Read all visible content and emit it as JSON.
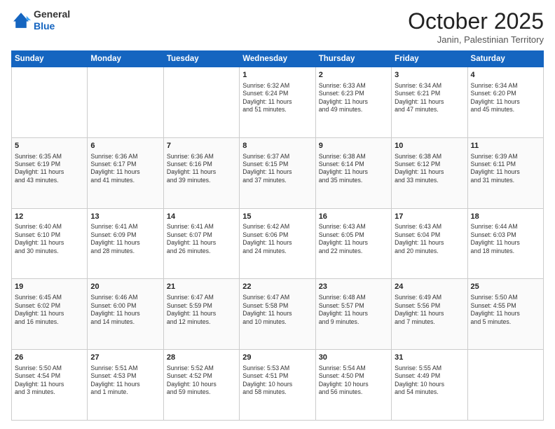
{
  "header": {
    "logo_line1": "General",
    "logo_line2": "Blue",
    "month": "October 2025",
    "location": "Janin, Palestinian Territory"
  },
  "weekdays": [
    "Sunday",
    "Monday",
    "Tuesday",
    "Wednesday",
    "Thursday",
    "Friday",
    "Saturday"
  ],
  "weeks": [
    [
      {
        "day": "",
        "info": ""
      },
      {
        "day": "",
        "info": ""
      },
      {
        "day": "",
        "info": ""
      },
      {
        "day": "1",
        "info": "Sunrise: 6:32 AM\nSunset: 6:24 PM\nDaylight: 11 hours\nand 51 minutes."
      },
      {
        "day": "2",
        "info": "Sunrise: 6:33 AM\nSunset: 6:23 PM\nDaylight: 11 hours\nand 49 minutes."
      },
      {
        "day": "3",
        "info": "Sunrise: 6:34 AM\nSunset: 6:21 PM\nDaylight: 11 hours\nand 47 minutes."
      },
      {
        "day": "4",
        "info": "Sunrise: 6:34 AM\nSunset: 6:20 PM\nDaylight: 11 hours\nand 45 minutes."
      }
    ],
    [
      {
        "day": "5",
        "info": "Sunrise: 6:35 AM\nSunset: 6:19 PM\nDaylight: 11 hours\nand 43 minutes."
      },
      {
        "day": "6",
        "info": "Sunrise: 6:36 AM\nSunset: 6:17 PM\nDaylight: 11 hours\nand 41 minutes."
      },
      {
        "day": "7",
        "info": "Sunrise: 6:36 AM\nSunset: 6:16 PM\nDaylight: 11 hours\nand 39 minutes."
      },
      {
        "day": "8",
        "info": "Sunrise: 6:37 AM\nSunset: 6:15 PM\nDaylight: 11 hours\nand 37 minutes."
      },
      {
        "day": "9",
        "info": "Sunrise: 6:38 AM\nSunset: 6:14 PM\nDaylight: 11 hours\nand 35 minutes."
      },
      {
        "day": "10",
        "info": "Sunrise: 6:38 AM\nSunset: 6:12 PM\nDaylight: 11 hours\nand 33 minutes."
      },
      {
        "day": "11",
        "info": "Sunrise: 6:39 AM\nSunset: 6:11 PM\nDaylight: 11 hours\nand 31 minutes."
      }
    ],
    [
      {
        "day": "12",
        "info": "Sunrise: 6:40 AM\nSunset: 6:10 PM\nDaylight: 11 hours\nand 30 minutes."
      },
      {
        "day": "13",
        "info": "Sunrise: 6:41 AM\nSunset: 6:09 PM\nDaylight: 11 hours\nand 28 minutes."
      },
      {
        "day": "14",
        "info": "Sunrise: 6:41 AM\nSunset: 6:07 PM\nDaylight: 11 hours\nand 26 minutes."
      },
      {
        "day": "15",
        "info": "Sunrise: 6:42 AM\nSunset: 6:06 PM\nDaylight: 11 hours\nand 24 minutes."
      },
      {
        "day": "16",
        "info": "Sunrise: 6:43 AM\nSunset: 6:05 PM\nDaylight: 11 hours\nand 22 minutes."
      },
      {
        "day": "17",
        "info": "Sunrise: 6:43 AM\nSunset: 6:04 PM\nDaylight: 11 hours\nand 20 minutes."
      },
      {
        "day": "18",
        "info": "Sunrise: 6:44 AM\nSunset: 6:03 PM\nDaylight: 11 hours\nand 18 minutes."
      }
    ],
    [
      {
        "day": "19",
        "info": "Sunrise: 6:45 AM\nSunset: 6:02 PM\nDaylight: 11 hours\nand 16 minutes."
      },
      {
        "day": "20",
        "info": "Sunrise: 6:46 AM\nSunset: 6:00 PM\nDaylight: 11 hours\nand 14 minutes."
      },
      {
        "day": "21",
        "info": "Sunrise: 6:47 AM\nSunset: 5:59 PM\nDaylight: 11 hours\nand 12 minutes."
      },
      {
        "day": "22",
        "info": "Sunrise: 6:47 AM\nSunset: 5:58 PM\nDaylight: 11 hours\nand 10 minutes."
      },
      {
        "day": "23",
        "info": "Sunrise: 6:48 AM\nSunset: 5:57 PM\nDaylight: 11 hours\nand 9 minutes."
      },
      {
        "day": "24",
        "info": "Sunrise: 6:49 AM\nSunset: 5:56 PM\nDaylight: 11 hours\nand 7 minutes."
      },
      {
        "day": "25",
        "info": "Sunrise: 5:50 AM\nSunset: 4:55 PM\nDaylight: 11 hours\nand 5 minutes."
      }
    ],
    [
      {
        "day": "26",
        "info": "Sunrise: 5:50 AM\nSunset: 4:54 PM\nDaylight: 11 hours\nand 3 minutes."
      },
      {
        "day": "27",
        "info": "Sunrise: 5:51 AM\nSunset: 4:53 PM\nDaylight: 11 hours\nand 1 minute."
      },
      {
        "day": "28",
        "info": "Sunrise: 5:52 AM\nSunset: 4:52 PM\nDaylight: 10 hours\nand 59 minutes."
      },
      {
        "day": "29",
        "info": "Sunrise: 5:53 AM\nSunset: 4:51 PM\nDaylight: 10 hours\nand 58 minutes."
      },
      {
        "day": "30",
        "info": "Sunrise: 5:54 AM\nSunset: 4:50 PM\nDaylight: 10 hours\nand 56 minutes."
      },
      {
        "day": "31",
        "info": "Sunrise: 5:55 AM\nSunset: 4:49 PM\nDaylight: 10 hours\nand 54 minutes."
      },
      {
        "day": "",
        "info": ""
      }
    ]
  ]
}
